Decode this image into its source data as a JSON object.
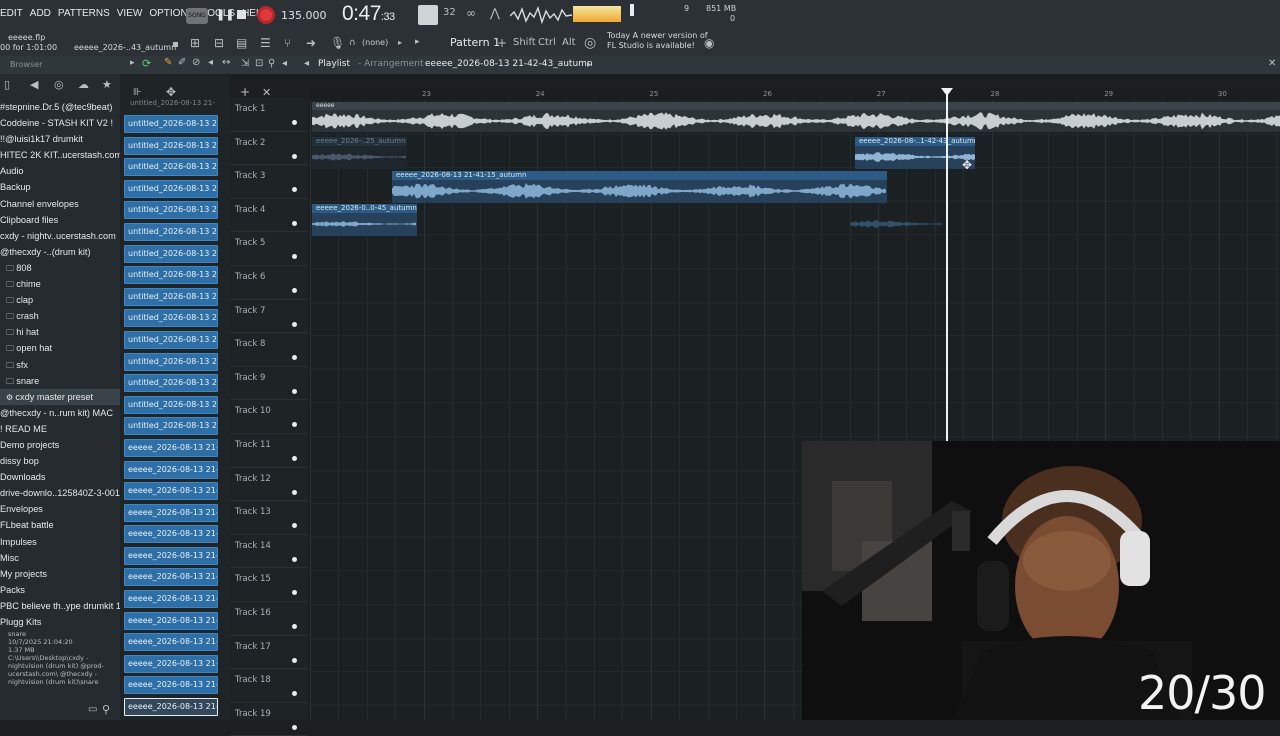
{
  "menu": [
    "EDIT",
    "ADD",
    "PATTERNS",
    "VIEW",
    "OPTIONS",
    "TOOLS",
    "HELP"
  ],
  "transport": {
    "mode": "SONG",
    "tempo": "135.000",
    "time_main": "0:47",
    "time_sub": ":33",
    "cpu": "9",
    "memory": "851 MB",
    "voices": "0"
  },
  "project": {
    "file": "eeeee.flp",
    "length": "00 for 1:01:00",
    "pattern_file": "eeeee_2026-..43_autumn"
  },
  "toolbar": {
    "snap": "(none)",
    "pattern": "Pattern 1",
    "shift": "Shift",
    "ctrl": "Ctrl",
    "alt": "Alt",
    "news_line1": "Today  A newer version of",
    "news_line2": "FL Studio is available!"
  },
  "panels": {
    "browser_label": "Browser",
    "playlist_label": "Playlist",
    "arrangement_label": "Arrangement",
    "arrangement_name": "eeeee_2026-08-13 21-42-43_autumn"
  },
  "browser": {
    "items": [
      {
        "label": "#stepnine.Dr.5 (@tec9beat)"
      },
      {
        "label": "Coddeine - STASH KIT V2 !"
      },
      {
        "label": "!!@luisi1k17 drumkit"
      },
      {
        "label": "HITEC 2K KIT..ucerstash.com"
      },
      {
        "label": "Audio"
      },
      {
        "label": "Backup"
      },
      {
        "label": "Channel envelopes"
      },
      {
        "label": "Clipboard files"
      },
      {
        "label": "cxdy - nightv..ucerstash.com"
      },
      {
        "label": "@thecxdy -..(drum kit)"
      },
      {
        "label": "808",
        "sub": true
      },
      {
        "label": "chime",
        "sub": true
      },
      {
        "label": "clap",
        "sub": true
      },
      {
        "label": "crash",
        "sub": true
      },
      {
        "label": "hi hat",
        "sub": true
      },
      {
        "label": "open hat",
        "sub": true
      },
      {
        "label": "sfx",
        "sub": true
      },
      {
        "label": "snare",
        "sub": true
      },
      {
        "label": "cxdy master preset",
        "sub": true,
        "selected": true
      },
      {
        "label": "@thecxdy - n..rum kit) MAC"
      },
      {
        "label": "! READ ME"
      },
      {
        "label": "Demo projects"
      },
      {
        "label": "dissy bop"
      },
      {
        "label": "Downloads"
      },
      {
        "label": "drive-downlo..125840Z-3-001"
      },
      {
        "label": "Envelopes"
      },
      {
        "label": "FLbeat battle"
      },
      {
        "label": "Impulses"
      },
      {
        "label": "Misc"
      },
      {
        "label": "My projects"
      },
      {
        "label": "Packs"
      },
      {
        "label": "PBC believe th..ype drumkit 1"
      },
      {
        "label": "Plugg Kits"
      }
    ],
    "file_info": {
      "name": "snare",
      "date": "10/7/2025 21:04:20",
      "size": "1.37 MB",
      "path": "C:\\Users\\\\Desktop\\cxdy - nightvision (drum kit) @prod-ucerstash.com\\ @thecxdy - nightvision (drum kit)\\snare"
    }
  },
  "channels": [
    "untitled_2026-08-13 21-",
    "untitled_2026-08-13 21-",
    "untitled_2026-08-13 21-",
    "untitled_2026-08-13 21-",
    "untitled_2026-08-13 21-",
    "untitled_2026-08-13 21-",
    "untitled_2026-08-13 21-",
    "untitled_2026-08-13 21-",
    "untitled_2026-08-13 21-",
    "untitled_2026-08-13 21-",
    "untitled_2026-08-13 21-",
    "untitled_2026-08-13 21-",
    "untitled_2026-08-13 21-",
    "untitled_2026-08-13 21-",
    "untitled_2026-08-13 21-",
    "eeeee_2026-08-13 21-3..",
    "eeeee_2026-08-13 21-3..",
    "eeeee_2026-08-13 21-3..",
    "eeeee_2026-08-13 21-3..",
    "eeeee_2026-08-13 21-3..",
    "eeeee_2026-08-13 21-3..",
    "eeeee_2026-08-13 21-3..",
    "eeeee_2026-08-13 21-4..",
    "eeeee_2026-08-13 21-4..",
    "eeeee_2026-08-13 21-4..",
    "eeeee_2026-08-13 21-4..",
    "eeeee_2026-08-13 21-4..",
    "eeeee_2026-08-13 21-4.."
  ],
  "tracks": [
    "Track 1",
    "Track 2",
    "Track 3",
    "Track 4",
    "Track 5",
    "Track 6",
    "Track 7",
    "Track 8",
    "Track 9",
    "Track 10",
    "Track 11",
    "Track 12",
    "Track 13",
    "Track 14",
    "Track 15",
    "Track 16",
    "Track 17",
    "Track 18",
    "Track 19"
  ],
  "ruler_bars": [
    "23",
    "24",
    "25",
    "26",
    "27",
    "28",
    "29",
    "30"
  ],
  "clips": {
    "track1": "eeeee",
    "track2a": "eeeee_2026-..25_autumn",
    "track2b": "eeeee_2026-08-..1-42-43_autumn",
    "track3": "eeeee_2026-08-13 21-41-15_autumn",
    "track4": "eeeee_2026-0..0-45_autumn"
  },
  "overlay": {
    "counter": "20/30"
  },
  "colors": {
    "clip": "#2c5c86",
    "channel": "#2e6fa8",
    "record": "#e0383c"
  }
}
